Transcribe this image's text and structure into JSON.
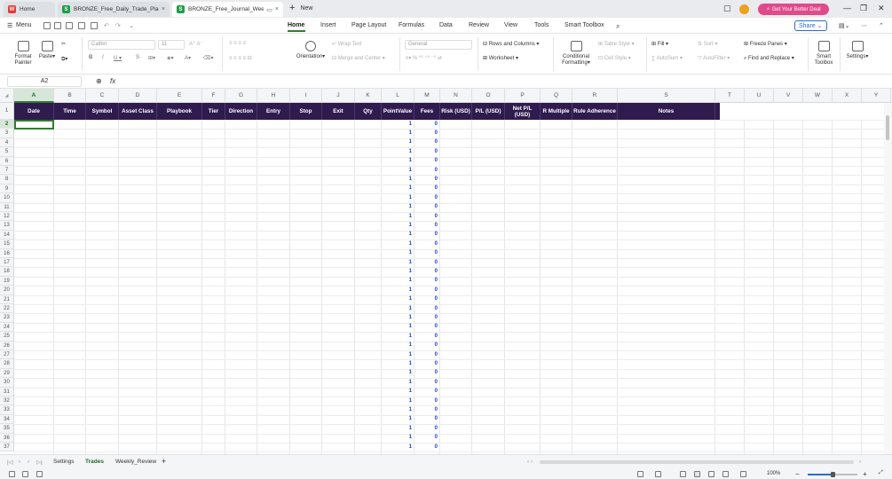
{
  "tabs": [
    {
      "label": "Home",
      "icon": "wps-icon"
    },
    {
      "label": "BRONZE_Free_Daily_Trade_Plan (I",
      "icon": "sheet-icon"
    },
    {
      "label": "BRONZE_Free_Journal_Weekl",
      "icon": "sheet-icon"
    }
  ],
  "new_tab_label": "New",
  "deal_button": "Get Your Better Deal",
  "menu": {
    "menu_label": "Menu",
    "items": [
      "Home",
      "Insert",
      "Page Layout",
      "Formulas",
      "Data",
      "Review",
      "View",
      "Tools",
      "Smart Toolbox"
    ],
    "share_label": "Share"
  },
  "ribbon": {
    "format_painter": "Format\nPainter",
    "paste": "Paste",
    "font_name": "Calibri",
    "font_size": "11",
    "orientation": "Orientation",
    "wrap_text": "Wrap Text",
    "merge_center": "Merge and Center",
    "number_format": "General",
    "rows_columns": "Rows and Columns",
    "worksheet": "Worksheet",
    "conditional_formatting": "Conditional\nFormatting",
    "table_style": "Table Style",
    "cell_style": "Cell Style",
    "fill": "Fill",
    "sort": "Sort",
    "autosum": "AutoSum",
    "autofilter": "AutoFilter",
    "freeze_panes": "Freeze Panes",
    "find_replace": "Find and Replace",
    "smart_toolbox": "Smart\nToolbox",
    "settings": "Settings"
  },
  "formula_bar": {
    "name_box": "A2",
    "fx": "fx",
    "content": ""
  },
  "columns": [
    "A",
    "B",
    "C",
    "D",
    "E",
    "F",
    "G",
    "H",
    "I",
    "J",
    "K",
    "L",
    "M",
    "N",
    "O",
    "P",
    "Q",
    "R",
    "S",
    "T",
    "U",
    "V",
    "W",
    "X",
    "Y"
  ],
  "header_cells": [
    "Date",
    "Time",
    "Symbol",
    "Asset Class",
    "Playbook",
    "Tier",
    "Direction",
    "Entry",
    "Stop",
    "Exit",
    "Qty",
    "PointValue",
    "Fees",
    "Risk (USD)",
    "P/L (USD)",
    "Net P/L (USD)",
    "R Multiple",
    "Rule Adherence",
    "Notes"
  ],
  "row_numbers": [
    "1",
    "2",
    "3",
    "4",
    "5",
    "6",
    "7",
    "8",
    "9",
    "10",
    "11",
    "12",
    "13",
    "14",
    "15",
    "16",
    "17",
    "18",
    "19",
    "20",
    "21",
    "22",
    "23",
    "24",
    "25",
    "26",
    "27",
    "28",
    "29",
    "30",
    "31",
    "32",
    "33",
    "34",
    "35",
    "36",
    "37"
  ],
  "point_value_default": "1",
  "fees_default": "0",
  "sheet_tabs": [
    "Settings",
    "Trades",
    "Weekly_Review"
  ],
  "active_sheet": "Trades",
  "zoom": "100%",
  "colors": {
    "header_bg": "#2f1b4e",
    "accent": "#2e7d32",
    "number_blue": "#1f3ed6",
    "deal_pink": "#e04a8a"
  }
}
